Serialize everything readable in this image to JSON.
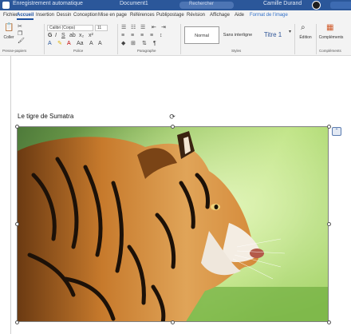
{
  "titlebar": {
    "autosave_label": "Enregistrement automatique",
    "filename": "Document1",
    "search_placeholder": "Rechercher",
    "user_name": "Camille Durand"
  },
  "tabs": [
    {
      "label": "Fichier",
      "active": false
    },
    {
      "label": "Accueil",
      "active": true
    },
    {
      "label": "Insertion",
      "active": false
    },
    {
      "label": "Dessin",
      "active": false
    },
    {
      "label": "Conception",
      "active": false
    },
    {
      "label": "Mise en page",
      "active": false
    },
    {
      "label": "Références",
      "active": false
    },
    {
      "label": "Publipostage",
      "active": false
    },
    {
      "label": "Révision",
      "active": false
    },
    {
      "label": "Affichage",
      "active": false
    },
    {
      "label": "Aide",
      "active": false
    },
    {
      "label": "Format de l'image",
      "active": false
    }
  ],
  "ribbon": {
    "clipboard": {
      "paste_label": "Coller",
      "group_label": "Presse-papiers"
    },
    "font": {
      "family": "Calibri (Corps)",
      "size": "11",
      "group_label": "Police"
    },
    "paragraph": {
      "group_label": "Paragraphe"
    },
    "styles": {
      "items": [
        "Normal",
        "Sans interligne",
        "Titre 1"
      ],
      "group_label": "Styles"
    },
    "editing": {
      "label": "Édition"
    },
    "addins": {
      "label": "Compléments",
      "group_label": "Compléments"
    }
  },
  "document": {
    "heading": "Le tigre de Sumatra"
  },
  "colors": {
    "titlebar": "#2b579a",
    "ribbon_bg": "#f3f3f3",
    "accent": "#1a4fa0"
  }
}
